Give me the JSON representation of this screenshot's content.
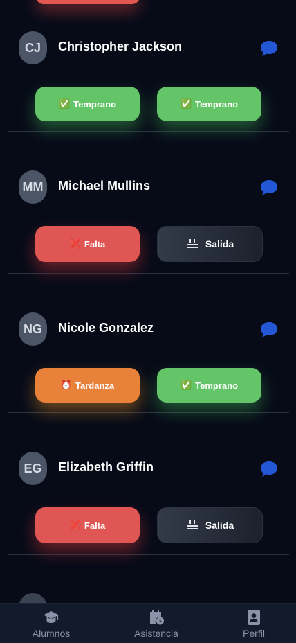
{
  "students": [
    {
      "initials": "CJ",
      "name": "Christopher Jackson",
      "buttons": [
        {
          "emoji": "✅",
          "label": "Temprano",
          "status": "temprano"
        },
        {
          "emoji": "✅",
          "label": "Temprano",
          "status": "temprano"
        }
      ]
    },
    {
      "initials": "MM",
      "name": "Michael Mullins",
      "buttons": [
        {
          "emoji": "❌",
          "label": "Falta",
          "status": "falta"
        },
        {
          "label": "Salida",
          "status": "salida"
        }
      ]
    },
    {
      "initials": "NG",
      "name": "Nicole Gonzalez",
      "buttons": [
        {
          "emoji": "⏰",
          "label": "Tardanza",
          "status": "tardanza"
        },
        {
          "emoji": "✅",
          "label": "Temprano",
          "status": "temprano"
        }
      ]
    },
    {
      "initials": "EG",
      "name": "Elizabeth Griffin",
      "buttons": [
        {
          "emoji": "❌",
          "label": "Falta",
          "status": "falta"
        },
        {
          "label": "Salida",
          "status": "salida"
        }
      ]
    }
  ],
  "nav": {
    "alumnos": "Alumnos",
    "asistencia": "Asistencia",
    "perfil": "Perfil"
  },
  "colors": {
    "temprano": "#63c567",
    "falta": "#e05654",
    "tardanza": "#e8813a",
    "salida": "#2a313d",
    "comment_icon": "#2457d6",
    "background": "#070b18"
  }
}
